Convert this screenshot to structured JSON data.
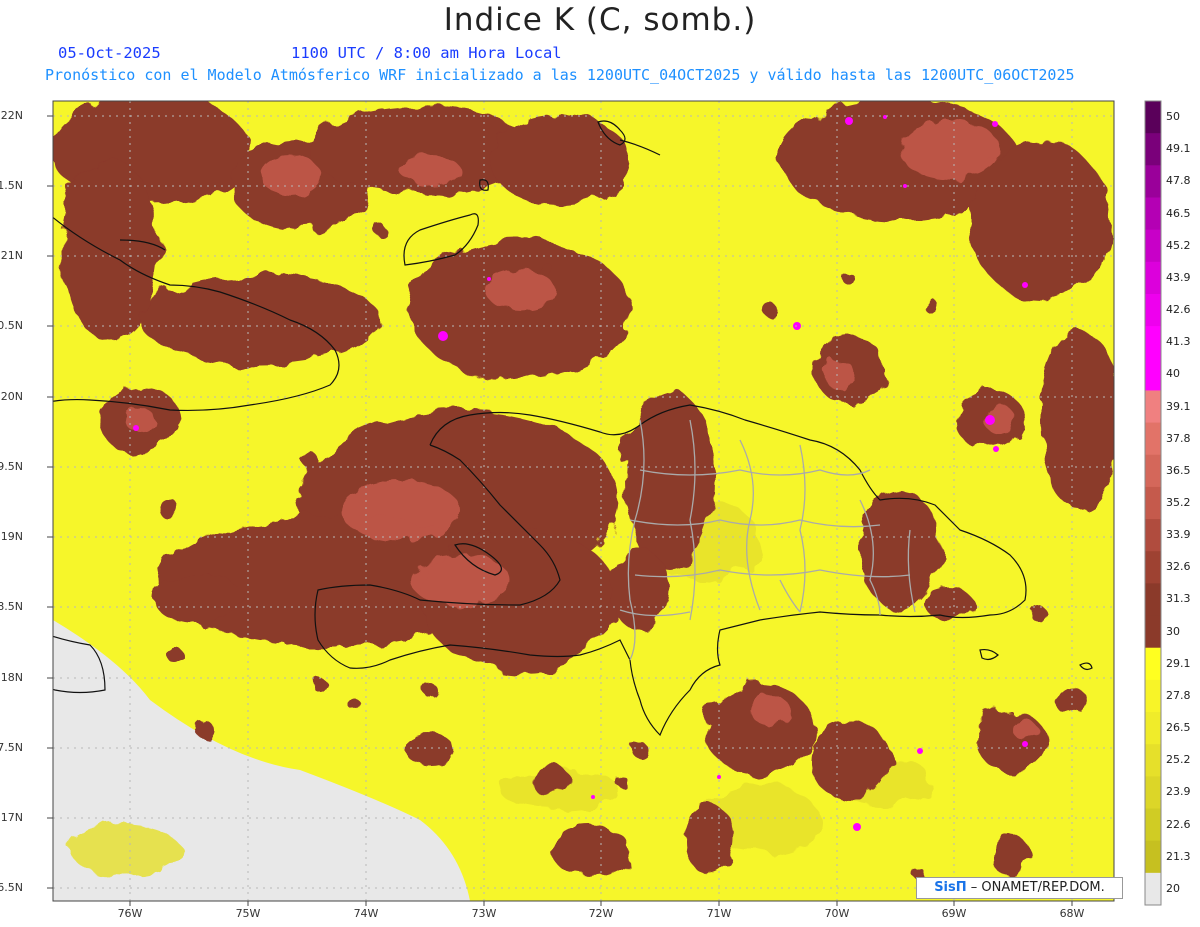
{
  "header": {
    "title": "Indice K (C, somb.)",
    "date": "05-Oct-2025",
    "time": "1100 UTC / 8:00 am Hora Local",
    "model_line": "Pronóstico con el Modelo Atmósferico WRF inicializado a las 1200UTC_04OCT2025 y válido hasta las  1200UTC_06OCT2025"
  },
  "colors": {
    "title": "#222222",
    "date": "#1a3cff",
    "model_line": "#1e90ff",
    "background_land_nodata": "#e8e8e8",
    "low_k": "#f6f62a",
    "high_k": "#8b3a2a",
    "very_high_k": "#ff00ff"
  },
  "axes": {
    "lat_labels": [
      "22N",
      "21.5N",
      "21N",
      "20.5N",
      "20N",
      "19.5N",
      "19N",
      "18.5N",
      "18N",
      "17.5N",
      "17N",
      "16.5N"
    ],
    "lon_labels": [
      "76W",
      "75W",
      "74W",
      "73W",
      "72W",
      "71W",
      "70W",
      "69W",
      "68W"
    ]
  },
  "colorbar": {
    "labels": [
      "50",
      "49.1",
      "47.8",
      "46.5",
      "45.2",
      "43.9",
      "42.6",
      "41.3",
      "40",
      "39.1",
      "37.8",
      "36.5",
      "35.2",
      "33.9",
      "32.6",
      "31.3",
      "30",
      "29.1",
      "27.8",
      "26.5",
      "25.2",
      "23.9",
      "22.6",
      "21.3",
      "20"
    ],
    "colors": [
      "#5a005a",
      "#7a007a",
      "#9a009a",
      "#b400b4",
      "#c800c8",
      "#dc00dc",
      "#ee00ee",
      "#ff00ff",
      "#ff00ff",
      "#f08080",
      "#e27368",
      "#d4675a",
      "#c55a4c",
      "#b04c3e",
      "#9e4232",
      "#8b3a2a",
      "#8b3a2a",
      "#ffff20",
      "#f8f428",
      "#f0ec2a",
      "#e6e02a",
      "#dcd628",
      "#d0cc24",
      "#c6c020",
      "#e8e8e8"
    ]
  },
  "credit": {
    "brand": "SisΠ",
    "text": "– ONAMET/REP.DOM."
  }
}
